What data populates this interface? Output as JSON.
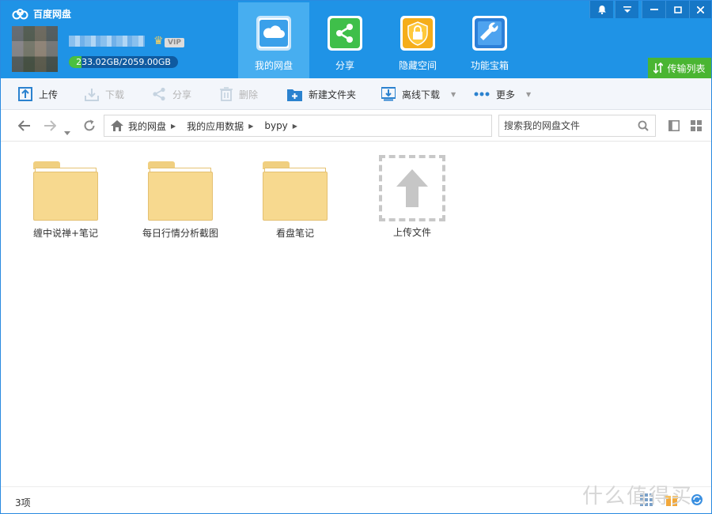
{
  "app": {
    "title": "百度网盘"
  },
  "account": {
    "quota_text": "233.02GB/2059.00GB",
    "quota_used_fraction": 0.113,
    "vip_label": "VIP"
  },
  "nav": {
    "tabs": [
      {
        "label": "我的网盘",
        "icon": "cloud-icon",
        "active": true
      },
      {
        "label": "分享",
        "icon": "share-icon"
      },
      {
        "label": "隐藏空间",
        "icon": "lock-icon"
      },
      {
        "label": "功能宝箱",
        "icon": "wrench-icon"
      }
    ],
    "transfer_label": "传输列表"
  },
  "toolbar": {
    "upload": "上传",
    "download": "下载",
    "share": "分享",
    "delete": "删除",
    "new_folder": "新建文件夹",
    "offline_download": "离线下载",
    "more": "更多"
  },
  "breadcrumb": [
    "我的网盘",
    "我的应用数据",
    "bypy"
  ],
  "search": {
    "placeholder": "搜索我的网盘文件"
  },
  "files": [
    {
      "name": "缠中说禅+笔记",
      "type": "folder"
    },
    {
      "name": "每日行情分析截图",
      "type": "folder"
    },
    {
      "name": "看盘笔记",
      "type": "folder"
    }
  ],
  "upload_tile": {
    "label": "上传文件"
  },
  "status": {
    "count": "3项"
  },
  "watermark": "什么值得买",
  "colors": {
    "header": "#1f93e6",
    "active_tab": "#47aef0",
    "transfer": "#4ab532",
    "folder": "#f7d98f"
  }
}
